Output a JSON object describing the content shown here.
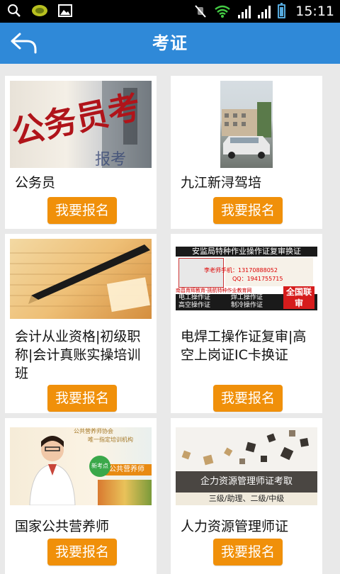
{
  "status_bar": {
    "time": "15:11",
    "icons": [
      "search-icon",
      "app-notification-icon",
      "image-icon",
      "mute-icon",
      "wifi-icon",
      "signal-icon",
      "signal-icon",
      "battery-icon"
    ]
  },
  "header": {
    "title": "考证",
    "back_icon": "back-arrow-icon",
    "background": "#2f89d8"
  },
  "accent_color": "#f0900a",
  "cards": [
    {
      "title": "公务员",
      "button": "我要报名",
      "image": {
        "caption": "公务员考",
        "extra": "报考"
      }
    },
    {
      "title": "九江新浔驾培",
      "button": "我要报名"
    },
    {
      "title": "会计从业资格|初级职称|会计真账实操培训班",
      "button": "我要报名"
    },
    {
      "title": "电焊工操作证复审|高空上岗证IC卡换证",
      "button": "我要报名",
      "image": {
        "banner": "安监局特种作业操作证复审换证",
        "teacher_line": "李老师手机：13170888052",
        "qq_line": "QQ：1941755715",
        "org": "南昌育辉教育-挑航特种作业教育网",
        "item1": "电工操作证",
        "item2": "焊工操作证",
        "item3": "高空操作证",
        "item4": "制冷操作证",
        "stamp": "全国联审"
      }
    },
    {
      "title": "国家公共营养师",
      "button": "我要报名",
      "image": {
        "assoc": "公共营养师协会",
        "sub": "唯一指定培训机构",
        "label": "公共营养师",
        "badge": "新考点"
      }
    },
    {
      "title": "人力资源管理师证",
      "button": "我要报名",
      "image": {
        "band": "企力资源管理师证考取",
        "levels": "三级/助理、二级/中级"
      }
    }
  ]
}
